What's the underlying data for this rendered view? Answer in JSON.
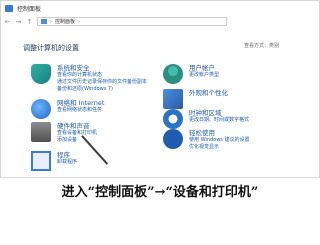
{
  "window": {
    "title": "控制面板"
  },
  "address": {
    "crumbs": [
      "控制面板"
    ]
  },
  "main": {
    "heading": "调整计算机的设置",
    "view_by": "查看方式：类别"
  },
  "categories_left": [
    {
      "title": "系统和安全",
      "links": [
        "查看你的计算机状态",
        "通过文件历史记录保存你的文件备份副本",
        "备份和还原(Windows 7)"
      ]
    },
    {
      "title": "网络和 Internet",
      "links": [
        "查看网络状态和任务"
      ]
    },
    {
      "title": "硬件和声音",
      "links": [
        "查看设备和打印机",
        "添加设备"
      ]
    },
    {
      "title": "程序",
      "links": [
        "卸载程序"
      ]
    }
  ],
  "categories_right": [
    {
      "title": "用户帐户",
      "links": [
        "更改帐户类型"
      ]
    },
    {
      "title": "外观和个性化",
      "links": []
    },
    {
      "title": "时钟和区域",
      "links": [
        "更改日期、时间或数字格式"
      ]
    },
    {
      "title": "轻松使用",
      "links": [
        "使用 Windows 建议的设置",
        "优化视觉显示"
      ]
    }
  ],
  "caption": "进入“控制面板”→“设备和打印机”"
}
